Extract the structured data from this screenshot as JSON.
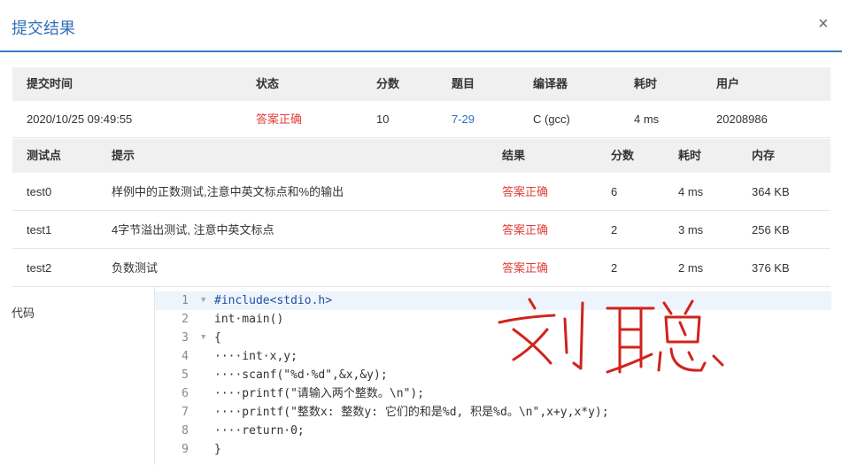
{
  "dialog": {
    "title": "提交结果",
    "close": "×"
  },
  "summary": {
    "headers": [
      "提交时间",
      "状态",
      "分数",
      "题目",
      "编译器",
      "耗时",
      "用户"
    ],
    "row": {
      "time": "2020/10/25 09:49:55",
      "status": "答案正确",
      "score": "10",
      "problem": "7-29",
      "compiler": "C (gcc)",
      "elapsed": "4 ms",
      "user": "20208986"
    }
  },
  "tests": {
    "headers": [
      "测试点",
      "提示",
      "结果",
      "分数",
      "耗时",
      "内存"
    ],
    "rows": [
      {
        "id": "test0",
        "hint": "样例中的正数测试,注意中英文标点和%的输出",
        "result": "答案正确",
        "score": "6",
        "time": "4 ms",
        "memory": "364 KB"
      },
      {
        "id": "test1",
        "hint": "4字节溢出测试, 注意中英文标点",
        "result": "答案正确",
        "score": "2",
        "time": "3 ms",
        "memory": "256 KB"
      },
      {
        "id": "test2",
        "hint": "负数测试",
        "result": "答案正确",
        "score": "2",
        "time": "2 ms",
        "memory": "376 KB"
      }
    ]
  },
  "code": {
    "label": "代码",
    "lines": [
      {
        "n": "1",
        "text": "#include<stdio.h>"
      },
      {
        "n": "2",
        "text": "int·main()"
      },
      {
        "n": "3",
        "text": "{"
      },
      {
        "n": "4",
        "text": "····int·x,y;"
      },
      {
        "n": "5",
        "text": "····scanf(\"%d·%d\",&x,&y);"
      },
      {
        "n": "6",
        "text": "····printf(\"请输入两个整数。\\n\");"
      },
      {
        "n": "7",
        "text": "····printf(\"整数x: 整数y: 它们的和是%d, 积是%d。\\n\",x+y,x*y);"
      },
      {
        "n": "8",
        "text": "····return·0;"
      },
      {
        "n": "9",
        "text": "}"
      }
    ]
  },
  "signature": {
    "text": "刘聪",
    "color": "#d0241c"
  },
  "colors": {
    "accent": "#2f6fb8",
    "success": "#e0403a",
    "header_bg": "#f0f0f0"
  }
}
